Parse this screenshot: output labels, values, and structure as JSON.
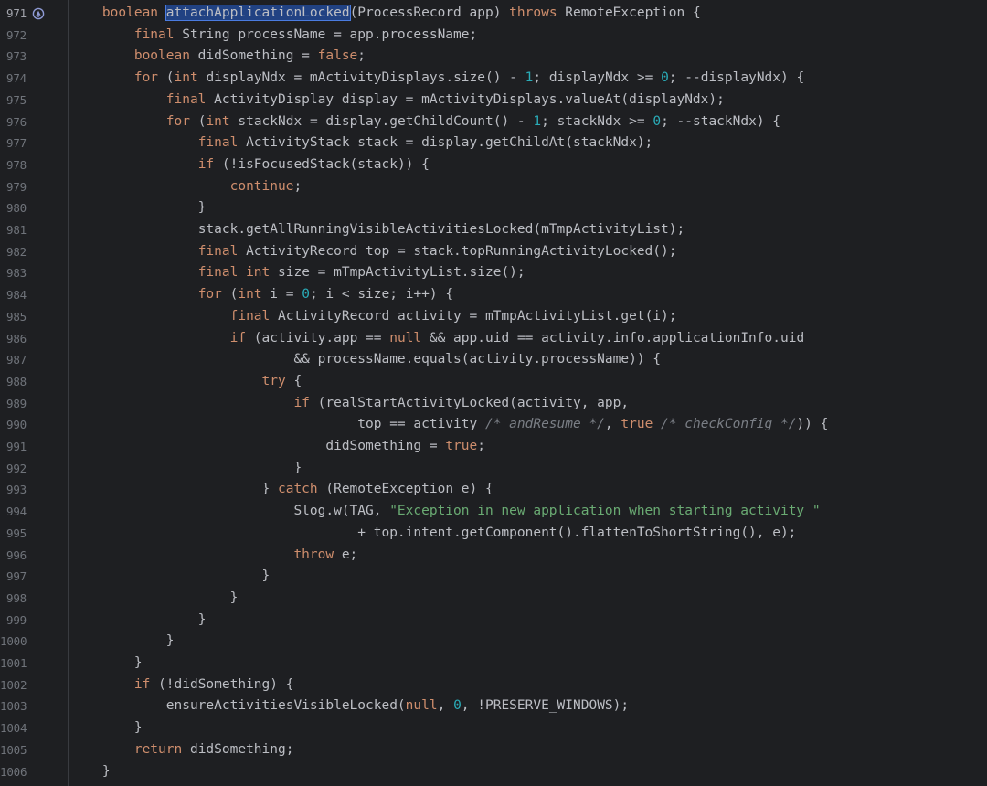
{
  "editor": {
    "language": "java",
    "indent_unit": 4,
    "gutter_icon": "implementation-marker-icon",
    "current_line": 971,
    "colors": {
      "background": "#1e1f22",
      "keyword": "#cf8e6d",
      "number": "#2aacb8",
      "string": "#6aab73",
      "comment": "#7a7e85",
      "default": "#bcbec4",
      "line_number": "#6f737a",
      "selection": "#214283"
    },
    "lines": [
      {
        "n": "971",
        "indent": 0,
        "tokens": [
          {
            "t": "kw",
            "v": "boolean"
          },
          {
            "t": "",
            "v": " "
          },
          {
            "t": "hl",
            "v": "attachApplicationLocked"
          },
          {
            "t": "",
            "v": "(ProcessRecord app) "
          },
          {
            "t": "kw",
            "v": "throws"
          },
          {
            "t": "",
            "v": " RemoteException {"
          }
        ]
      },
      {
        "n": "972",
        "indent": 1,
        "tokens": [
          {
            "t": "kw",
            "v": "final"
          },
          {
            "t": "",
            "v": " String processName = app.processName;"
          }
        ]
      },
      {
        "n": "973",
        "indent": 1,
        "tokens": [
          {
            "t": "kw",
            "v": "boolean"
          },
          {
            "t": "",
            "v": " didSomething = "
          },
          {
            "t": "kw",
            "v": "false"
          },
          {
            "t": "",
            "v": ";"
          }
        ]
      },
      {
        "n": "974",
        "indent": 1,
        "tokens": [
          {
            "t": "kw",
            "v": "for"
          },
          {
            "t": "",
            "v": " ("
          },
          {
            "t": "kw",
            "v": "int"
          },
          {
            "t": "",
            "v": " displayNdx = mActivityDisplays.size() - "
          },
          {
            "t": "num",
            "v": "1"
          },
          {
            "t": "",
            "v": "; displayNdx >= "
          },
          {
            "t": "num",
            "v": "0"
          },
          {
            "t": "",
            "v": "; --displayNdx) {"
          }
        ]
      },
      {
        "n": "975",
        "indent": 2,
        "tokens": [
          {
            "t": "kw",
            "v": "final"
          },
          {
            "t": "",
            "v": " ActivityDisplay display = mActivityDisplays.valueAt(displayNdx);"
          }
        ]
      },
      {
        "n": "976",
        "indent": 2,
        "tokens": [
          {
            "t": "kw",
            "v": "for"
          },
          {
            "t": "",
            "v": " ("
          },
          {
            "t": "kw",
            "v": "int"
          },
          {
            "t": "",
            "v": " stackNdx = display.getChildCount() - "
          },
          {
            "t": "num",
            "v": "1"
          },
          {
            "t": "",
            "v": "; stackNdx >= "
          },
          {
            "t": "num",
            "v": "0"
          },
          {
            "t": "",
            "v": "; --stackNdx) {"
          }
        ]
      },
      {
        "n": "977",
        "indent": 3,
        "tokens": [
          {
            "t": "kw",
            "v": "final"
          },
          {
            "t": "",
            "v": " ActivityStack stack = display.getChildAt(stackNdx);"
          }
        ]
      },
      {
        "n": "978",
        "indent": 3,
        "tokens": [
          {
            "t": "kw",
            "v": "if"
          },
          {
            "t": "",
            "v": " (!isFocusedStack(stack)) {"
          }
        ]
      },
      {
        "n": "979",
        "indent": 4,
        "tokens": [
          {
            "t": "kw",
            "v": "continue"
          },
          {
            "t": "",
            "v": ";"
          }
        ]
      },
      {
        "n": "980",
        "indent": 3,
        "tokens": [
          {
            "t": "",
            "v": "}"
          }
        ]
      },
      {
        "n": "981",
        "indent": 3,
        "tokens": [
          {
            "t": "",
            "v": "stack.getAllRunningVisibleActivitiesLocked(mTmpActivityList);"
          }
        ]
      },
      {
        "n": "982",
        "indent": 3,
        "tokens": [
          {
            "t": "kw",
            "v": "final"
          },
          {
            "t": "",
            "v": " ActivityRecord top = stack.topRunningActivityLocked();"
          }
        ]
      },
      {
        "n": "983",
        "indent": 3,
        "tokens": [
          {
            "t": "kw",
            "v": "final"
          },
          {
            "t": "",
            "v": " "
          },
          {
            "t": "kw",
            "v": "int"
          },
          {
            "t": "",
            "v": " size = mTmpActivityList.size();"
          }
        ]
      },
      {
        "n": "984",
        "indent": 3,
        "tokens": [
          {
            "t": "kw",
            "v": "for"
          },
          {
            "t": "",
            "v": " ("
          },
          {
            "t": "kw",
            "v": "int"
          },
          {
            "t": "",
            "v": " i = "
          },
          {
            "t": "num",
            "v": "0"
          },
          {
            "t": "",
            "v": "; i < size; i++) {"
          }
        ]
      },
      {
        "n": "985",
        "indent": 4,
        "tokens": [
          {
            "t": "kw",
            "v": "final"
          },
          {
            "t": "",
            "v": " ActivityRecord activity = mTmpActivityList.get(i);"
          }
        ]
      },
      {
        "n": "986",
        "indent": 4,
        "tokens": [
          {
            "t": "kw",
            "v": "if"
          },
          {
            "t": "",
            "v": " (activity.app == "
          },
          {
            "t": "kw",
            "v": "null"
          },
          {
            "t": "",
            "v": " && app.uid == activity.info.applicationInfo.uid"
          }
        ]
      },
      {
        "n": "987",
        "indent": 6,
        "tokens": [
          {
            "t": "",
            "v": "&& processName.equals(activity.processName)) {"
          }
        ]
      },
      {
        "n": "988",
        "indent": 5,
        "tokens": [
          {
            "t": "kw",
            "v": "try"
          },
          {
            "t": "",
            "v": " {"
          }
        ]
      },
      {
        "n": "989",
        "indent": 6,
        "tokens": [
          {
            "t": "kw",
            "v": "if"
          },
          {
            "t": "",
            "v": " (realStartActivityLocked(activity, app,"
          }
        ]
      },
      {
        "n": "990",
        "indent": 8,
        "tokens": [
          {
            "t": "",
            "v": "top == activity "
          },
          {
            "t": "cmt",
            "v": "/* andResume */"
          },
          {
            "t": "",
            "v": ", "
          },
          {
            "t": "kw",
            "v": "true"
          },
          {
            "t": "",
            "v": " "
          },
          {
            "t": "cmt",
            "v": "/* checkConfig */"
          },
          {
            "t": "",
            "v": ")) {"
          }
        ]
      },
      {
        "n": "991",
        "indent": 7,
        "tokens": [
          {
            "t": "",
            "v": "didSomething = "
          },
          {
            "t": "kw",
            "v": "true"
          },
          {
            "t": "",
            "v": ";"
          }
        ]
      },
      {
        "n": "992",
        "indent": 6,
        "tokens": [
          {
            "t": "",
            "v": "}"
          }
        ]
      },
      {
        "n": "993",
        "indent": 5,
        "tokens": [
          {
            "t": "",
            "v": "} "
          },
          {
            "t": "kw",
            "v": "catch"
          },
          {
            "t": "",
            "v": " (RemoteException e) {"
          }
        ]
      },
      {
        "n": "994",
        "indent": 6,
        "tokens": [
          {
            "t": "",
            "v": "Slog.w(TAG, "
          },
          {
            "t": "str",
            "v": "\"Exception in new application when starting activity \""
          }
        ]
      },
      {
        "n": "995",
        "indent": 8,
        "tokens": [
          {
            "t": "",
            "v": "+ top.intent.getComponent().flattenToShortString(), e);"
          }
        ]
      },
      {
        "n": "996",
        "indent": 6,
        "tokens": [
          {
            "t": "kw",
            "v": "throw"
          },
          {
            "t": "",
            "v": " e;"
          }
        ]
      },
      {
        "n": "997",
        "indent": 5,
        "tokens": [
          {
            "t": "",
            "v": "}"
          }
        ]
      },
      {
        "n": "998",
        "indent": 4,
        "tokens": [
          {
            "t": "",
            "v": "}"
          }
        ]
      },
      {
        "n": "999",
        "indent": 3,
        "tokens": [
          {
            "t": "",
            "v": "}"
          }
        ]
      },
      {
        "n": "1000",
        "indent": 2,
        "tokens": [
          {
            "t": "",
            "v": "}"
          }
        ]
      },
      {
        "n": "1001",
        "indent": 1,
        "tokens": [
          {
            "t": "",
            "v": "}"
          }
        ]
      },
      {
        "n": "1002",
        "indent": 1,
        "tokens": [
          {
            "t": "kw",
            "v": "if"
          },
          {
            "t": "",
            "v": " (!didSomething) {"
          }
        ]
      },
      {
        "n": "1003",
        "indent": 2,
        "tokens": [
          {
            "t": "",
            "v": "ensureActivitiesVisibleLocked("
          },
          {
            "t": "kw",
            "v": "null"
          },
          {
            "t": "",
            "v": ", "
          },
          {
            "t": "num",
            "v": "0"
          },
          {
            "t": "",
            "v": ", !PRESERVE_WINDOWS);"
          }
        ]
      },
      {
        "n": "1004",
        "indent": 1,
        "tokens": [
          {
            "t": "",
            "v": "}"
          }
        ]
      },
      {
        "n": "1005",
        "indent": 1,
        "tokens": [
          {
            "t": "kw",
            "v": "return"
          },
          {
            "t": "",
            "v": " didSomething;"
          }
        ]
      },
      {
        "n": "1006",
        "indent": 0,
        "tokens": [
          {
            "t": "",
            "v": "}"
          }
        ]
      }
    ]
  }
}
